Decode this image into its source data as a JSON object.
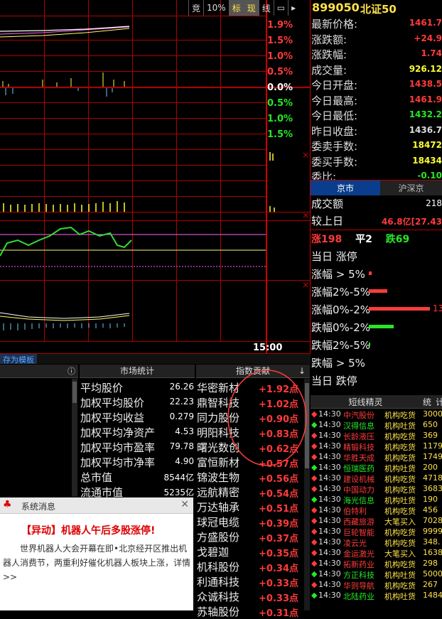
{
  "toolbar": {
    "items": [
      "竞",
      "10%",
      "标",
      "现",
      "线"
    ]
  },
  "stock": {
    "code": "899050",
    "name": "北证50"
  },
  "chart": {
    "pct_labels": [
      {
        "text": "1.9%",
        "color": "#ff3b3b"
      },
      {
        "text": "1.5%",
        "color": "#ff3b3b"
      },
      {
        "text": "1.0%",
        "color": "#ff3b3b"
      },
      {
        "text": "0.5%",
        "color": "#ff3b3b"
      },
      {
        "text": "0.0%",
        "color": "#ffffff"
      },
      {
        "text": "0.5%",
        "color": "#27e627"
      },
      {
        "text": "1.0%",
        "color": "#27e627"
      },
      {
        "text": "1.5%",
        "color": "#27e627"
      }
    ],
    "time_label": "15:00"
  },
  "quote": {
    "rows": [
      {
        "label": "最新价格:",
        "value": "1461.7",
        "color": "#ff3b3b"
      },
      {
        "label": "涨跌额:",
        "value": "+24.9",
        "color": "#ff3b3b"
      },
      {
        "label": "涨跌幅:",
        "value": "1.74",
        "color": "#ff3b3b"
      },
      {
        "label": "成交量:",
        "value": "926.12",
        "color": "#ffff33"
      },
      {
        "label": "今日开盘:",
        "value": "1438.5",
        "color": "#ff3b3b"
      },
      {
        "label": "今日最高:",
        "value": "1461.9",
        "color": "#ff3b3b"
      },
      {
        "label": "今日最低:",
        "value": "1432.2",
        "color": "#27e627"
      },
      {
        "label": "昨日收盘:",
        "value": "1436.7",
        "color": "#dddddd"
      },
      {
        "label": "委卖手数:",
        "value": "18472",
        "color": "#ffff33"
      },
      {
        "label": "委买手数:",
        "value": "18434",
        "color": "#ffff33"
      },
      {
        "label": "委比:",
        "value": "-0.10",
        "color": "#27e627"
      }
    ],
    "tabs": [
      "京市",
      "沪深京"
    ],
    "turnover_label": "成交额",
    "turnover_value": "218",
    "compare_label": "较上日",
    "compare_value": "46.8亿[27.43",
    "rise_label": "涨",
    "rise_count": "198",
    "flat_label": "平",
    "flat_count": "2",
    "fall_label": "跌",
    "fall_count": "69",
    "limit_up_label": "当日 涨停",
    "dist": [
      {
        "label": "涨幅 > 5%",
        "value": "",
        "color": "#ff3b3b",
        "width": 0.05
      },
      {
        "label": "涨幅2%-5%",
        "value": "",
        "color": "#ff3b3b",
        "width": 0.3
      },
      {
        "label": "涨幅0%-2%",
        "value": "13",
        "color": "#ff3b3b",
        "width": 1.0
      },
      {
        "label": "跌幅0%-2%",
        "value": "",
        "color": "#27e627",
        "width": 0.41
      },
      {
        "label": "跌幅2%-5%",
        "value": "",
        "color": "#27e627",
        "width": 0.02
      },
      {
        "label": "跌幅 > 5%",
        "value": "",
        "color": "#27e627",
        "width": 0
      }
    ],
    "limit_down_label": "当日 跌停"
  },
  "template_tab": "存为模板",
  "stats": {
    "title": "市场统计",
    "rows": [
      {
        "label": "平均股价",
        "value": "26.26"
      },
      {
        "label": "加权平均股价",
        "value": "22.23"
      },
      {
        "label": "加权平均收益",
        "value": "0.279"
      },
      {
        "label": "加权平均净资产",
        "value": "4.53"
      },
      {
        "label": "加权平均市盈率",
        "value": "79.78"
      },
      {
        "label": "加权平均市净率",
        "value": "4.90"
      },
      {
        "label": "总市值",
        "value": "8544亿"
      },
      {
        "label": "流通市值",
        "value": "5235亿"
      }
    ]
  },
  "contrib": {
    "title": "指数贡献",
    "rows": [
      {
        "name": "华密新材",
        "value": "+1.92点"
      },
      {
        "name": "鼎智科技",
        "value": "+1.02点"
      },
      {
        "name": "同力股份",
        "value": "+0.90点"
      },
      {
        "name": "明阳科技",
        "value": "+0.83点"
      },
      {
        "name": "曙光数创",
        "value": "+0.62点"
      },
      {
        "name": "富恒新材",
        "value": "+0.57点"
      },
      {
        "name": "锦波生物",
        "value": "+0.56点"
      },
      {
        "name": "远航精密",
        "value": "+0.54点"
      },
      {
        "name": "万达轴承",
        "value": "+0.51点"
      },
      {
        "name": "球冠电缆",
        "value": "+0.39点"
      },
      {
        "name": "方盛股份",
        "value": "+0.37点"
      },
      {
        "name": "戈碧迦",
        "value": "+0.35点"
      },
      {
        "name": "机科股份",
        "value": "+0.34点"
      },
      {
        "name": "利通科技",
        "value": "+0.33点"
      },
      {
        "name": "众诚科技",
        "value": "+0.33点"
      },
      {
        "name": "苏轴股份",
        "value": "+0.31点"
      }
    ]
  },
  "news": {
    "title": "短线精灵",
    "tab2": "统",
    "tab3": "计",
    "rows": [
      {
        "time": "14:30",
        "name": "中汽股份",
        "type": "机构吃货",
        "num": "3000",
        "up": true
      },
      {
        "time": "14:30",
        "name": "汉得信息",
        "type": "机构吐货",
        "num": "650",
        "up": false
      },
      {
        "time": "14:30",
        "name": "长龄液压",
        "type": "机构吃货",
        "num": "369",
        "up": true
      },
      {
        "time": "14:30",
        "name": "精锻科技",
        "type": "机构吃货",
        "num": "1179",
        "up": true
      },
      {
        "time": "14:30",
        "name": "华胜天成",
        "type": "机构吃货",
        "num": "1749",
        "up": true
      },
      {
        "time": "14:30",
        "name": "恒瑞医药",
        "type": "机构吐货",
        "num": "200",
        "up": false
      },
      {
        "time": "14:30",
        "name": "建设机械",
        "type": "机构吃货",
        "num": "4718",
        "up": true
      },
      {
        "time": "14:30",
        "name": "中国动力",
        "type": "机构吃货",
        "num": "3683",
        "up": true
      },
      {
        "time": "14:30",
        "name": "海光信息",
        "type": "机构吐货",
        "num": "190",
        "up": false
      },
      {
        "time": "14:30",
        "name": "伯特利",
        "type": "机构吃货",
        "num": "456",
        "up": true
      },
      {
        "time": "14:30",
        "name": "西藏旅游",
        "type": "大笔买入",
        "num": "7028",
        "up": true
      },
      {
        "time": "14:30",
        "name": "巨轮智能",
        "type": "机构吃货",
        "num": "9999",
        "up": true
      },
      {
        "time": "14:30",
        "name": "凌云光",
        "type": "机构吃货",
        "num": "348.",
        "up": true
      },
      {
        "time": "14:30",
        "name": "金运激光",
        "type": "大笔买入",
        "num": "1638",
        "up": true
      },
      {
        "time": "14:30",
        "name": "拓新药业",
        "type": "机构吃货",
        "num": "298",
        "up": true
      },
      {
        "time": "14:30",
        "name": "方正科技",
        "type": "机构吐货",
        "num": "5000",
        "up": false
      },
      {
        "time": "14:30",
        "name": "华则导航",
        "type": "机构吃货",
        "num": "267",
        "up": true
      },
      {
        "time": "14:30",
        "name": "北陆药业",
        "type": "机构吐货",
        "num": "1484",
        "up": false
      }
    ]
  },
  "popup": {
    "title": "系统消息",
    "headline": "【异动】机器人午后多股涨停!",
    "body": "世界机器人大会开幕在即•北京经开区推出机器人消费节，两重利好催化机器人板块上涨，详情>>"
  }
}
